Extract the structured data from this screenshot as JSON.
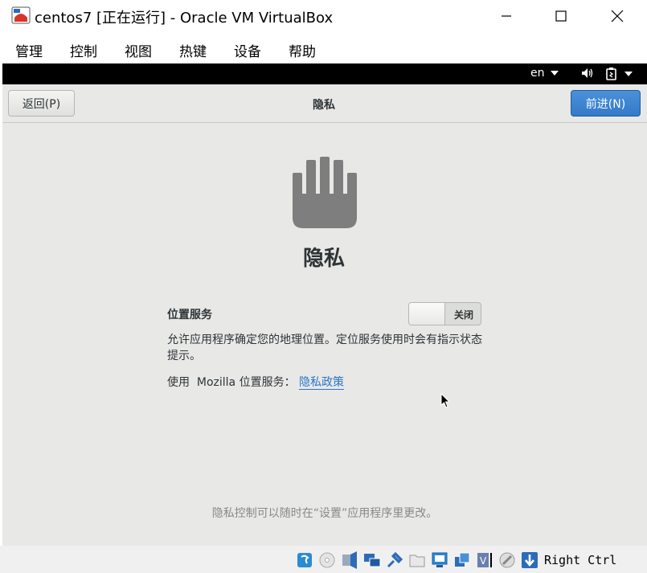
{
  "window": {
    "title": "centos7 [正在运行] - Oracle VM VirtualBox"
  },
  "menu": {
    "items": [
      {
        "label": "管理"
      },
      {
        "label": "控制"
      },
      {
        "label": "视图"
      },
      {
        "label": "热键"
      },
      {
        "label": "设备"
      },
      {
        "label": "帮助"
      }
    ]
  },
  "topbar": {
    "language": "en",
    "icons": [
      "volume-icon",
      "power-icon"
    ]
  },
  "header": {
    "back_label": "返回(P)",
    "title": "隐私",
    "next_label": "前进(N)"
  },
  "privacy": {
    "heading": "隐私",
    "location_label": "位置服务",
    "switch_state": "关闭",
    "description": "允许应用程序确定您的地理位置。定位服务使用时会有指示状态提示。",
    "mozilla_text": "使用  Mozilla 位置服务：",
    "policy_link": "隐私政策",
    "footer_note": "隐私控制可以随时在“设置”应用程序里更改。"
  },
  "statusbar": {
    "host_key": "Right Ctrl",
    "icons": [
      "hard-disk-icon",
      "optical-drive-icon",
      "audio-icon",
      "network-icon",
      "usb-icon",
      "shared-folders-icon",
      "display-icon",
      "video-capture-icon",
      "virtualization-icon",
      "mouse-integration-icon",
      "host-key-arrow-icon"
    ]
  },
  "colors": {
    "accent": "#357ac9",
    "link": "#2a76c6",
    "guest_background": "#e8e8e7"
  }
}
